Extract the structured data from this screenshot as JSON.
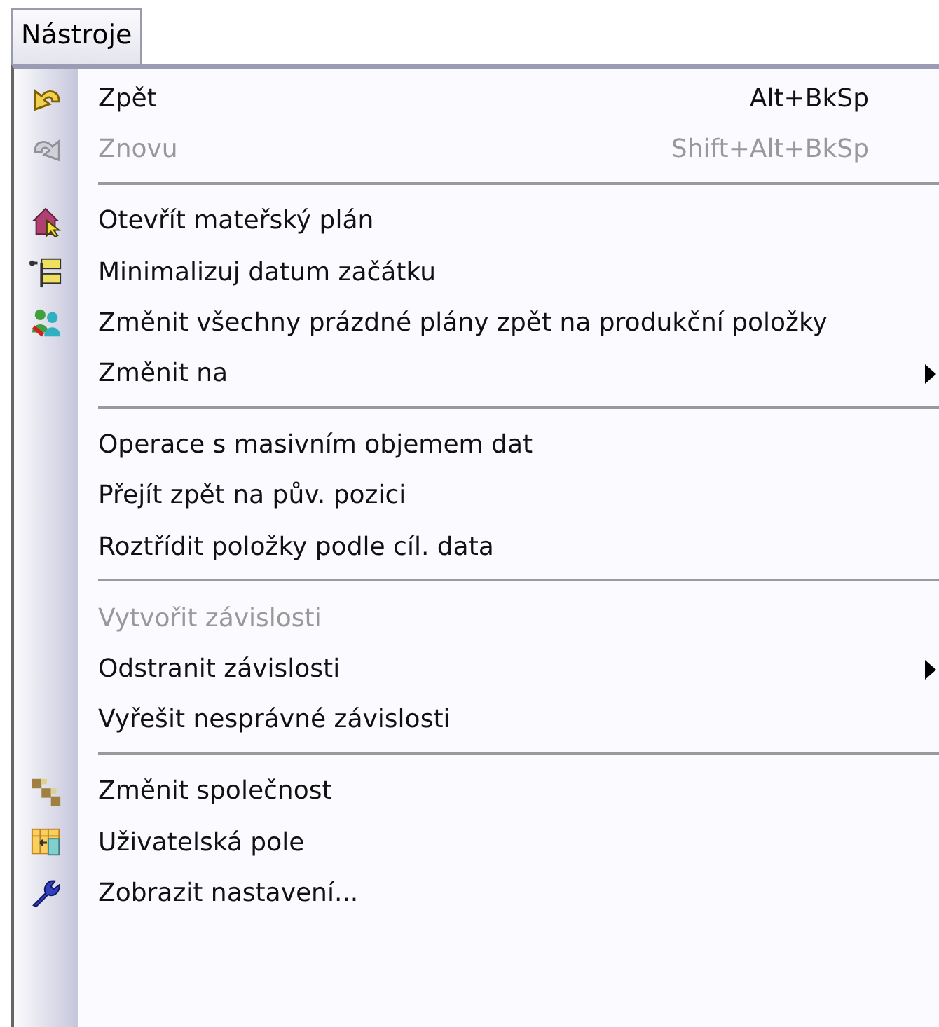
{
  "menu_title": "Nástroje",
  "items": [
    {
      "kind": "item",
      "label": "Zpět",
      "shortcut": "Alt+BkSp",
      "disabled": false
    },
    {
      "kind": "item",
      "label": "Znovu",
      "shortcut": "Shift+Alt+BkSp",
      "disabled": true
    },
    {
      "kind": "separator"
    },
    {
      "kind": "item",
      "label": "Otevřít mateřský plán",
      "disabled": false
    },
    {
      "kind": "item",
      "label": "Minimalizuj datum začátku",
      "disabled": false
    },
    {
      "kind": "item",
      "label": "Změnit všechny prázdné plány zpět na produkční položky",
      "disabled": false
    },
    {
      "kind": "item",
      "label": "Změnit na",
      "disabled": false,
      "submenu": true
    },
    {
      "kind": "separator"
    },
    {
      "kind": "item",
      "label": "Operace s masivním objemem dat",
      "disabled": false
    },
    {
      "kind": "item",
      "label": "Přejít zpět na pův. pozici",
      "disabled": false
    },
    {
      "kind": "item",
      "label": "Roztřídit položky podle cíl. data",
      "disabled": false
    },
    {
      "kind": "separator"
    },
    {
      "kind": "item",
      "label": "Vytvořit závislosti",
      "disabled": true
    },
    {
      "kind": "item",
      "label": "Odstranit závislosti",
      "disabled": false,
      "submenu": true
    },
    {
      "kind": "item",
      "label": "Vyřešit nesprávné závislosti",
      "disabled": false
    },
    {
      "kind": "separator"
    },
    {
      "kind": "item",
      "label": "Změnit společnost",
      "disabled": false
    },
    {
      "kind": "item",
      "label": "Uživatelská pole",
      "disabled": false
    },
    {
      "kind": "item",
      "label": "Zobrazit nastavení...",
      "disabled": false
    }
  ]
}
